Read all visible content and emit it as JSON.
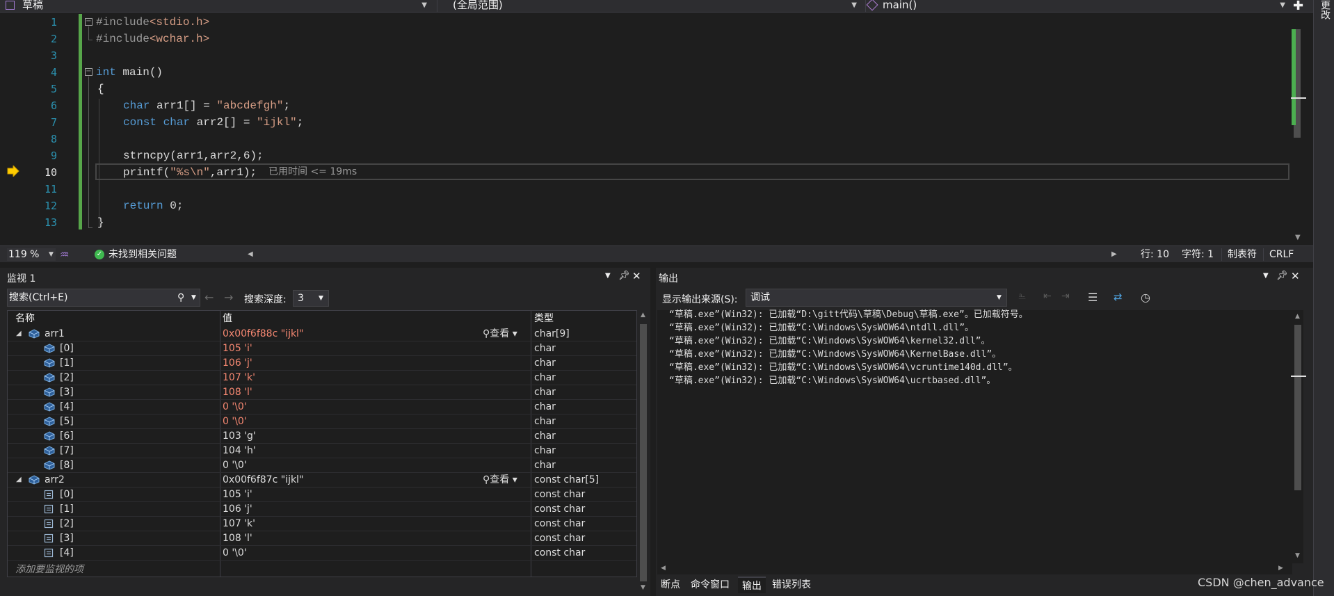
{
  "navbar": {
    "project": "草稿",
    "scope": "(全局范围)",
    "member": "main()"
  },
  "editor": {
    "lines": [
      {
        "num": "1"
      },
      {
        "num": "2"
      },
      {
        "num": "3"
      },
      {
        "num": "4"
      },
      {
        "num": "5"
      },
      {
        "num": "6"
      },
      {
        "num": "7"
      },
      {
        "num": "8"
      },
      {
        "num": "9"
      },
      {
        "num": "10"
      },
      {
        "num": "11"
      },
      {
        "num": "12"
      },
      {
        "num": "13"
      }
    ],
    "code": {
      "l1_kw": "#include",
      "l1_file": "<stdio.h>",
      "l2_kw": "#include",
      "l2_file": "<wchar.h>",
      "l4_type": "int",
      "l4_name": " main()",
      "l5": "{",
      "l6_type": "char",
      "l6_rest": " arr1[] = ",
      "l6_str": "\"abcdefgh\"",
      "l6_end": ";",
      "l7_const": "const",
      "l7_type": " char",
      "l7_rest": " arr2[] = ",
      "l7_str": "\"ijkl\"",
      "l7_end": ";",
      "l9_fn": "strncpy",
      "l9_rest": "(arr1,arr2,6);",
      "l10_fn": "printf",
      "l10_open": "(",
      "l10_str": "\"%s\\n\"",
      "l10_rest": ",arr1);",
      "l12_kw": "return",
      "l12_rest": " 0;",
      "l13": "}"
    },
    "elapsed": "已用时间 <= 19ms"
  },
  "status": {
    "zoom": "119 %",
    "issues": "未找到相关问题",
    "line": "行: 10",
    "char": "字符: 1",
    "tabs": "制表符",
    "eol": "CRLF"
  },
  "watch": {
    "title": "监视 1",
    "search_placeholder": "搜索(Ctrl+E)",
    "depth_label": "搜索深度:",
    "depth_value": "3",
    "columns": {
      "name": "名称",
      "value": "值",
      "type": "类型"
    },
    "view_label": "查看",
    "add_item": "添加要监视的项",
    "rows": [
      {
        "name": "arr1",
        "value": "0x00f6f88c \"ijkl\"",
        "type": "char[9]",
        "level": 0,
        "expanded": true,
        "changed": true,
        "view": true
      },
      {
        "name": "[0]",
        "value": "105 'i'",
        "type": "char",
        "level": 1,
        "changed": true
      },
      {
        "name": "[1]",
        "value": "106 'j'",
        "type": "char",
        "level": 1,
        "changed": true
      },
      {
        "name": "[2]",
        "value": "107 'k'",
        "type": "char",
        "level": 1,
        "changed": true
      },
      {
        "name": "[3]",
        "value": "108 'l'",
        "type": "char",
        "level": 1,
        "changed": true
      },
      {
        "name": "[4]",
        "value": "0 '\\0'",
        "type": "char",
        "level": 1,
        "changed": true
      },
      {
        "name": "[5]",
        "value": "0 '\\0'",
        "type": "char",
        "level": 1,
        "changed": true
      },
      {
        "name": "[6]",
        "value": "103 'g'",
        "type": "char",
        "level": 1,
        "changed": false
      },
      {
        "name": "[7]",
        "value": "104 'h'",
        "type": "char",
        "level": 1,
        "changed": false
      },
      {
        "name": "[8]",
        "value": "0 '\\0'",
        "type": "char",
        "level": 1,
        "changed": false
      },
      {
        "name": "arr2",
        "value": "0x00f6f87c \"ijkl\"",
        "type": "const char[5]",
        "level": 0,
        "expanded": true,
        "changed": false,
        "view": true
      },
      {
        "name": "[0]",
        "value": "105 'i'",
        "type": "const char",
        "level": 1,
        "changed": false,
        "const": true
      },
      {
        "name": "[1]",
        "value": "106 'j'",
        "type": "const char",
        "level": 1,
        "changed": false,
        "const": true
      },
      {
        "name": "[2]",
        "value": "107 'k'",
        "type": "const char",
        "level": 1,
        "changed": false,
        "const": true
      },
      {
        "name": "[3]",
        "value": "108 'l'",
        "type": "const char",
        "level": 1,
        "changed": false,
        "const": true
      },
      {
        "name": "[4]",
        "value": "0 '\\0'",
        "type": "const char",
        "level": 1,
        "changed": false,
        "const": true
      }
    ]
  },
  "output": {
    "title": "输出",
    "source_label": "显示输出来源(S):",
    "source_value": "调试",
    "lines": [
      "“草稿.exe”(Win32): 已加载“D:\\gitt代码\\草稿\\Debug\\草稿.exe”。已加载符号。",
      "“草稿.exe”(Win32): 已加载“C:\\Windows\\SysWOW64\\ntdll.dll”。",
      "“草稿.exe”(Win32): 已加载“C:\\Windows\\SysWOW64\\kernel32.dll”。",
      "“草稿.exe”(Win32): 已加载“C:\\Windows\\SysWOW64\\KernelBase.dll”。",
      "“草稿.exe”(Win32): 已加载“C:\\Windows\\SysWOW64\\vcruntime140d.dll”。",
      "“草稿.exe”(Win32): 已加载“C:\\Windows\\SysWOW64\\ucrtbased.dll”。"
    ]
  },
  "bottom_tabs": [
    "断点",
    "命令窗口",
    "输出",
    "错误列表"
  ],
  "side_label": "更改",
  "watermark": "CSDN @chen_advance",
  "colors": {
    "changed_value": "#f48771",
    "keyword": "#569cd6",
    "string": "#d69d85",
    "change_bar": "#57a64a"
  }
}
